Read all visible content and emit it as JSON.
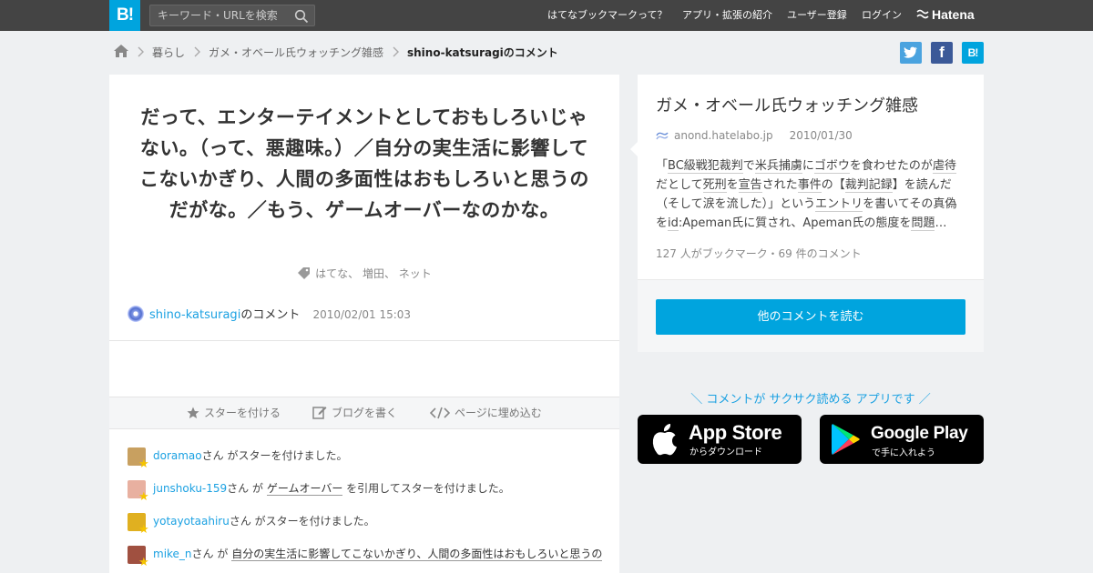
{
  "header": {
    "logo_text": "B!",
    "search_placeholder": "キーワード・URLを検索",
    "nav": [
      "はてなブックマークって？",
      "アプリ・拡張の紹介",
      "ユーザー登録",
      "ログイン"
    ],
    "brand": "Hatena"
  },
  "breadcrumb": {
    "items": [
      "暮らし",
      "ガメ・オベール氏ウォッチング雑感"
    ],
    "current": "shino-katsuragiのコメント"
  },
  "share": {
    "twitter": "t",
    "facebook": "f",
    "hatena": "B!"
  },
  "comment": {
    "text": "だって、エンターテイメントとしておもしろいじゃない。（って、悪趣味。）／自分の実生活に影響してこないかぎり、人間の多面性はおもしろいと思うのだがな。／もう、ゲームオーバーなのかな。",
    "tags": "はてな、 増田、 ネット",
    "author": "shino-katsuragi",
    "author_suffix": "のコメント",
    "timestamp": "2010/02/01 15:03"
  },
  "actions": {
    "star": "スターを付ける",
    "blog": "ブログを書く",
    "embed": "ページに埋め込む"
  },
  "stars": [
    {
      "user": "doramao",
      "text": "さん がスターを付けました。",
      "avatar_color": "#c8a060"
    },
    {
      "user": "junshoku-159",
      "mid": "さん が ",
      "quote": "ゲームオーバー",
      "text": " を引用してスターを付けました。",
      "avatar_color": "#e8b0a0"
    },
    {
      "user": "yotayotaahiru",
      "text": "さん がスターを付けました。",
      "avatar_color": "#e0b020"
    },
    {
      "user": "mike_n",
      "mid": "さん が ",
      "quote": "自分の実生活に影響してこないかぎり、人間の多面性はおもしろいと思うの",
      "text": "",
      "avatar_color": "#a05040"
    }
  ],
  "entry": {
    "title": "ガメ・オベール氏ウォッチング雑感",
    "site": "anond.hatelabo.jp",
    "date": "2010/01/30",
    "desc_1": "「",
    "desc_2": "BC級戦犯裁判",
    "desc_3": "で",
    "desc_4": "米兵捕虜",
    "desc_5": "に",
    "desc_6": "ゴボウ",
    "desc_7": "を食わせたのが",
    "desc_8": "虐待",
    "desc_9": "だとして",
    "desc_10": "死刑",
    "desc_11": "を",
    "desc_12": "宣告",
    "desc_13": "された",
    "desc_14": "事件",
    "desc_15": "の【",
    "desc_16": "裁判記録",
    "desc_17": "】を読んだ（そして涙を流した）」という",
    "desc_18": "エントリ",
    "desc_19": "を書いてその真偽を",
    "desc_20": "id",
    "desc_21": ":Apeman氏に質され、Apeman氏の態度を",
    "desc_22": "問題",
    "desc_23": "…",
    "stats": "127 人がブックマーク・69 件のコメント",
    "read_more": "他のコメントを読む"
  },
  "app_promo": {
    "text": "＼ コメントが サクサク読める アプリです ／",
    "appstore_big": "App Store",
    "appstore_small": "からダウンロード",
    "googleplay_big": "Google Play",
    "googleplay_small": "で手に入れよう"
  }
}
